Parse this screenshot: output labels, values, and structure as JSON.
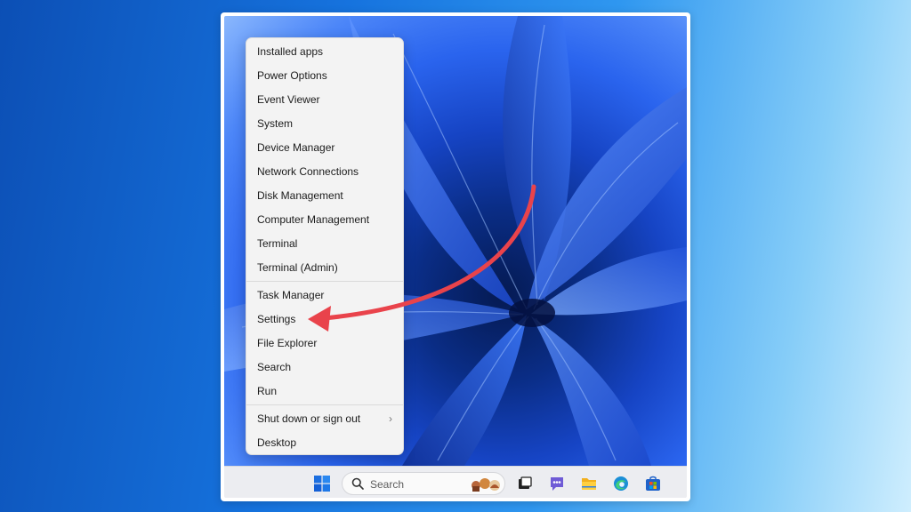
{
  "context_menu": {
    "items": [
      {
        "label": "Installed apps"
      },
      {
        "label": "Power Options"
      },
      {
        "label": "Event Viewer"
      },
      {
        "label": "System"
      },
      {
        "label": "Device Manager"
      },
      {
        "label": "Network Connections"
      },
      {
        "label": "Disk Management"
      },
      {
        "label": "Computer Management"
      },
      {
        "label": "Terminal"
      },
      {
        "label": "Terminal (Admin)"
      },
      {
        "label": "Task Manager"
      },
      {
        "label": "Settings"
      },
      {
        "label": "File Explorer"
      },
      {
        "label": "Search"
      },
      {
        "label": "Run"
      },
      {
        "label": "Shut down or sign out",
        "submenu_icon": "chevron-right-icon"
      },
      {
        "label": "Desktop"
      }
    ],
    "highlighted_item": "Settings"
  },
  "taskbar": {
    "search": {
      "placeholder": "Search"
    },
    "icons": [
      "windows-start-icon",
      "search-icon",
      "task-view-icon",
      "chat-icon",
      "file-explorer-icon",
      "edge-icon",
      "store-icon"
    ]
  },
  "annotation": {
    "type": "arrow",
    "color": "#e9434b",
    "points_to": "Settings"
  },
  "colors": {
    "accent": "#1d5fe6",
    "menu_background": "#f3f3f3",
    "arrow": "#e9434b"
  }
}
